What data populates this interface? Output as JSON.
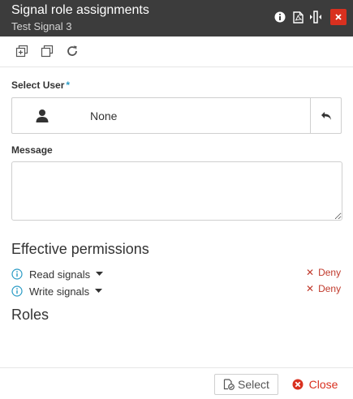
{
  "window": {
    "title": "Signal role assignments",
    "subtitle": "Test Signal 3",
    "header_icons": [
      "info-icon",
      "pdf-icon",
      "resize-horizontal-icon"
    ],
    "close_icon": "close-icon"
  },
  "toolbar": {
    "icons": [
      "expand-all-icon",
      "collapse-all-icon",
      "refresh-icon"
    ]
  },
  "select_user": {
    "label": "Select User",
    "required_marker": "*",
    "value": "None",
    "user_icon": "user-icon",
    "reset_icon": "undo-arrow-icon"
  },
  "message": {
    "label": "Message",
    "value": "",
    "placeholder": ""
  },
  "effective_permissions": {
    "title": "Effective permissions",
    "items": [
      {
        "name": "Read signals",
        "status": "Deny"
      },
      {
        "name": "Write signals",
        "status": "Deny"
      }
    ]
  },
  "roles": {
    "title": "Roles"
  },
  "footer": {
    "select_label": "Select",
    "close_label": "Close"
  },
  "colors": {
    "titlebar": "#3c3c3c",
    "close_red": "#d9301f",
    "deny_red": "#c0392b",
    "info_blue": "#2a9bc5"
  }
}
